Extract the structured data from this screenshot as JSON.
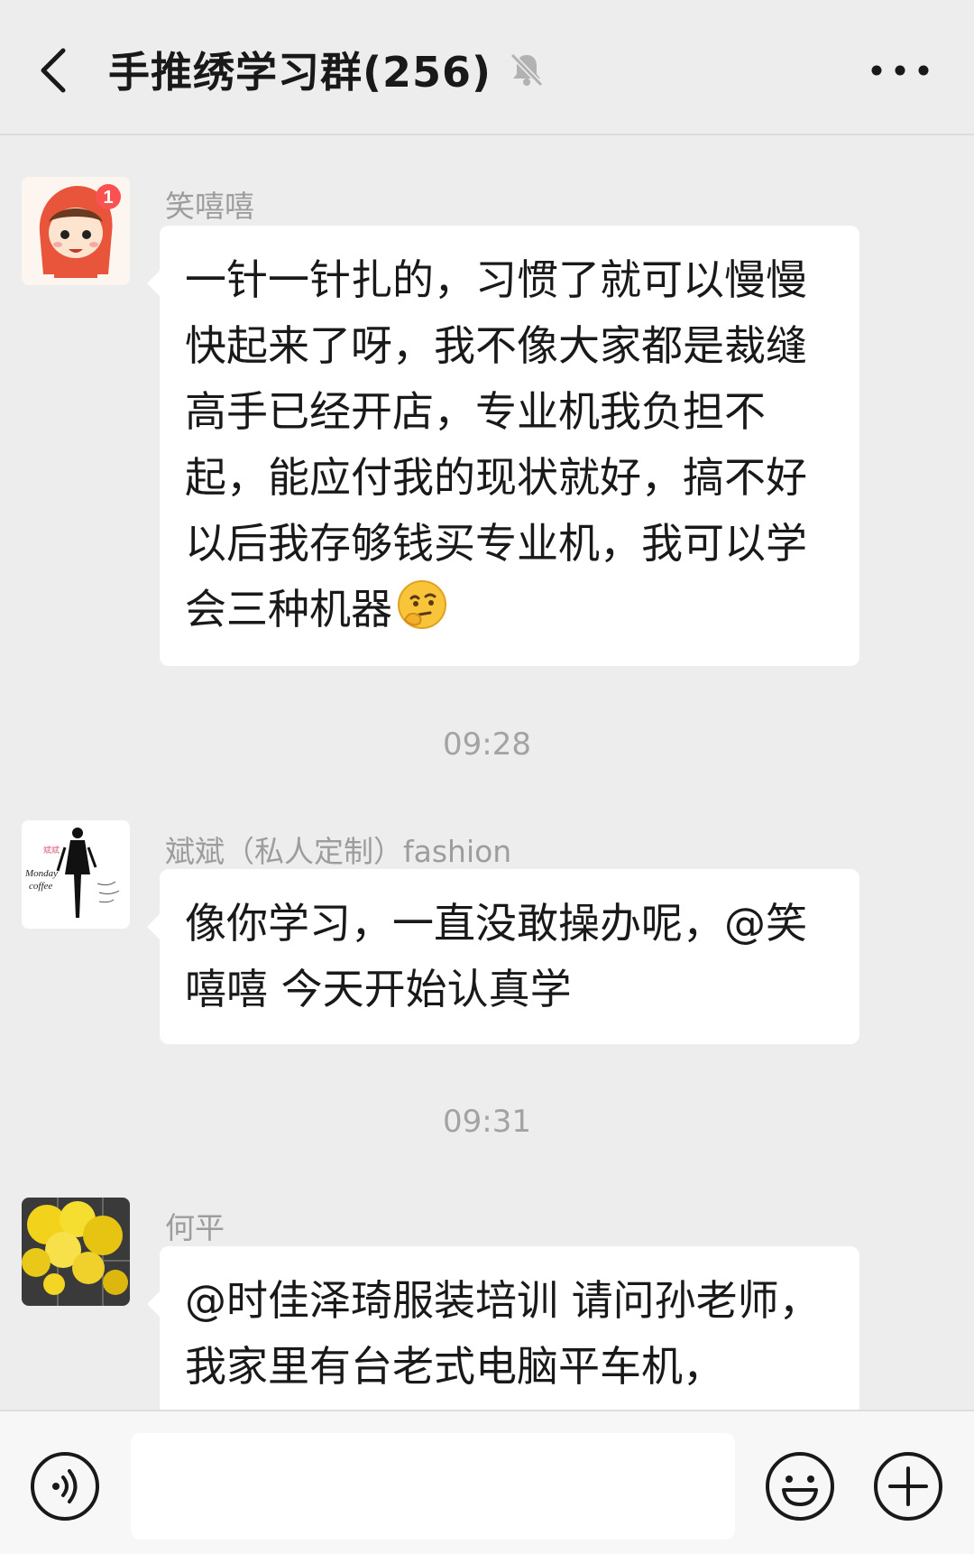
{
  "header": {
    "title": "手推绣学习群(256)",
    "back_icon": "chevron-left-icon",
    "mute_icon": "bell-muted-icon",
    "more_icon": "more-dots-icon"
  },
  "messages": [
    {
      "sender": "笑嘻嘻",
      "avatar": "cartoon-girl-red-hood-avatar",
      "avatar_badge": "1",
      "text": "一针一针扎的，习惯了就可以慢慢快起来了呀，我不像大家都是裁缝高手已经开店，专业机我负担不起，能应付我的现状就好，搞不好以后我存够钱买专业机，我可以学会三种机器",
      "emoji": "thinking-face-emoji"
    },
    {
      "time": "09:28"
    },
    {
      "sender": "斌斌（私人定制）fashion",
      "avatar": "fashion-sketch-avatar",
      "avatar_text_1": "Monday",
      "avatar_text_2": "coffee",
      "text": "像你学习，一直没敢操办呢，@笑嘻嘻  今天开始认真学"
    },
    {
      "time": "09:31"
    },
    {
      "sender": "何平",
      "avatar": "yellow-flowers-avatar",
      "text": "@时佳泽琦服装培训  请问孙老师，我家里有台老式电脑平车机，"
    }
  ],
  "input_bar": {
    "voice_icon": "voice-icon",
    "emoji_icon": "emoji-icon",
    "plus_icon": "plus-icon",
    "input_value": ""
  },
  "colors": {
    "background": "#ededed",
    "bubble": "#ffffff",
    "badge": "#fa5151",
    "meta_text": "#9d9d9d"
  }
}
